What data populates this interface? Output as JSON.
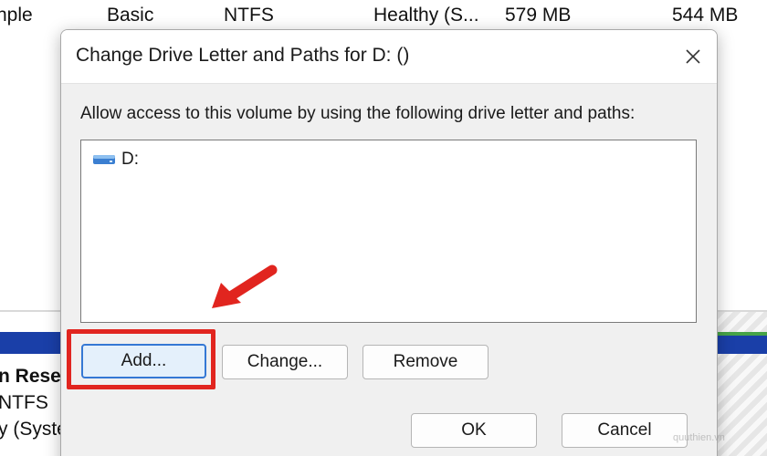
{
  "background": {
    "volume_row": {
      "layout": "nple",
      "type": "Basic",
      "file_system": "NTFS",
      "status": "Healthy (S...",
      "capacity": "579 MB",
      "free_space": "544 MB"
    },
    "partition": {
      "name": "n Rese",
      "file_system": "NTFS",
      "status": "y (Syste"
    },
    "accent_color": "#1a3fa8"
  },
  "dialog": {
    "title": "Change Drive Letter and Paths for D: ()",
    "instruction": "Allow access to this volume by using the following drive letter and paths:",
    "paths": [
      {
        "icon": "drive-icon",
        "label": "D:"
      }
    ],
    "buttons": {
      "add": "Add...",
      "change": "Change...",
      "remove": "Remove",
      "ok": "OK",
      "cancel": "Cancel"
    },
    "close_icon": "close-icon"
  },
  "annotation": {
    "highlight_color": "#e1251f",
    "highlight_target": "Add...",
    "arrow_icon": "arrow-icon"
  },
  "watermark": "quuthien.vn"
}
